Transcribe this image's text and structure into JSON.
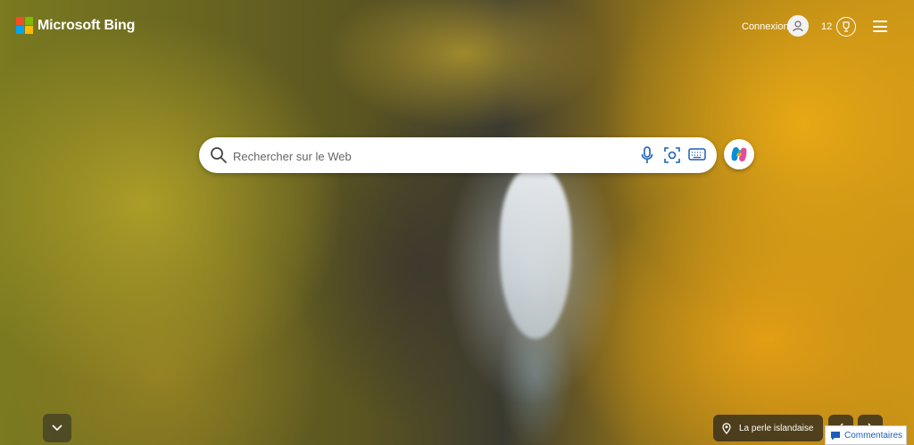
{
  "header": {
    "brand": "Microsoft Bing",
    "signin_label": "Connexion",
    "rewards_points": "12"
  },
  "search": {
    "placeholder": "Rechercher sur le Web"
  },
  "footer": {
    "location_label": "La perle islandaise",
    "feedback_label": "Commentaires"
  },
  "icons": {
    "logo": "microsoft-logo",
    "avatar": "user-icon",
    "rewards": "trophy-icon",
    "menu": "hamburger-icon",
    "search": "search-icon",
    "mic": "microphone-icon",
    "visual_search": "camera-lens-icon",
    "keyboard": "keyboard-icon",
    "copilot": "copilot-icon",
    "scroll": "chevron-down-icon",
    "location": "location-pin-icon",
    "feedback": "chat-bubble-icon"
  },
  "colors": {
    "ms_red": "#f25022",
    "ms_green": "#7fba00",
    "ms_blue": "#00a4ef",
    "ms_yellow": "#ffb900",
    "link_blue": "#1b5fb8"
  }
}
